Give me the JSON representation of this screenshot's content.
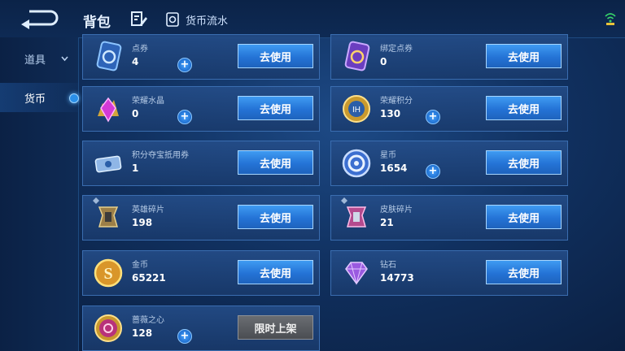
{
  "header": {
    "title": "背包",
    "flow_label": "货币流水"
  },
  "sidebar": {
    "items": [
      {
        "label": "道具"
      },
      {
        "label": "货币"
      }
    ]
  },
  "cards": [
    {
      "name": "点券",
      "value": "4",
      "action": "去使用",
      "icon": "ticket-icon"
    },
    {
      "name": "绑定点券",
      "value": "0",
      "action": "去使用",
      "icon": "bound-ticket-icon"
    },
    {
      "name": "荣耀水晶",
      "value": "0",
      "action": "去使用",
      "icon": "crystal-icon"
    },
    {
      "name": "荣耀积分",
      "value": "130",
      "action": "去使用",
      "icon": "honor-points-icon"
    },
    {
      "name": "积分夺宝抵用券",
      "value": "1",
      "action": "去使用",
      "icon": "coupon-icon"
    },
    {
      "name": "星币",
      "value": "1654",
      "action": "去使用",
      "icon": "star-coin-icon"
    },
    {
      "name": "英雄碎片",
      "value": "198",
      "action": "去使用",
      "icon": "hero-fragment-icon"
    },
    {
      "name": "皮肤碎片",
      "value": "21",
      "action": "去使用",
      "icon": "skin-fragment-icon"
    },
    {
      "name": "金币",
      "value": "65221",
      "action": "去使用",
      "icon": "gold-coin-icon"
    },
    {
      "name": "钻石",
      "value": "14773",
      "action": "去使用",
      "icon": "diamond-icon"
    },
    {
      "name": "蔷薇之心",
      "value": "128",
      "action": "限时上架",
      "icon": "rose-heart-icon"
    }
  ],
  "colors": {
    "accent": "#2a8fe8",
    "card_bg": "#254e8a",
    "button": "#2473d6",
    "disabled_button": "#4a4d52"
  }
}
